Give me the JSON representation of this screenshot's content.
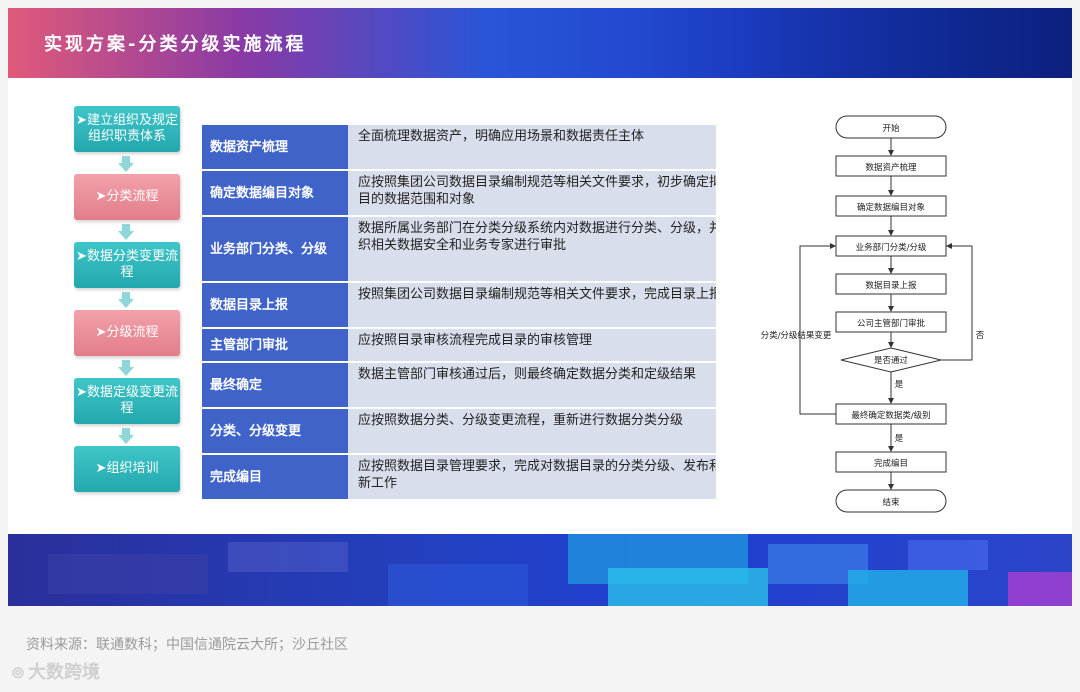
{
  "header": {
    "title": "实现方案-分类分级实施流程"
  },
  "steps": [
    {
      "label": "➤建立组织及规定组织职责体系",
      "color": "teal"
    },
    {
      "label": "➤分类流程",
      "color": "pink"
    },
    {
      "label": "➤数据分类变更流程",
      "color": "teal"
    },
    {
      "label": "➤分级流程",
      "color": "pink"
    },
    {
      "label": "➤数据定级变更流程",
      "color": "teal"
    },
    {
      "label": "➤组织培训",
      "color": "teal"
    }
  ],
  "table": [
    {
      "label": "数据资产梳理",
      "text": "全面梳理数据资产，明确应用场景和数据责任主体"
    },
    {
      "label": "确定数据编目对象",
      "text": "应按照集团公司数据目录编制规范等相关文件要求，初步确定拟编目的数据范围和对象"
    },
    {
      "label": "业务部门分类、分级",
      "text": "数据所属业务部门在分类分级系统内对数据进行分类、分级，并组织相关数据安全和业务专家进行审批"
    },
    {
      "label": "数据目录上报",
      "text": "按照集团公司数据目录编制规范等相关文件要求，完成目录上报"
    },
    {
      "label": "主管部门审批",
      "text": "应按照目录审核流程完成目录的审核管理"
    },
    {
      "label": "最终确定",
      "text": "数据主管部门审核通过后，则最终确定数据分类和定级结果"
    },
    {
      "label": "分类、分级变更",
      "text": "应按照数据分类、分级变更流程，重新进行数据分类分级"
    },
    {
      "label": "完成编目",
      "text": "应按照数据目录管理要求，完成对数据目录的分类分级、发布和更新工作"
    }
  ],
  "flowchart": {
    "start": "开始",
    "n1": "数据资产梳理",
    "n2": "确定数据编目对象",
    "n3": "业务部门分类/分级",
    "n4": "数据目录上报",
    "n5": "公司主管部门审批",
    "decision": "是否通过",
    "yes1": "是",
    "n6": "最终确定数据类/级别",
    "yes2": "是",
    "n7": "完成编目",
    "end": "结束",
    "left_loop": "分类/分级结果变更",
    "right_loop": "否"
  },
  "footer": {
    "source": "资料来源：联通数科；中国信通院云大所；沙丘社区",
    "logo": "大数跨境"
  }
}
